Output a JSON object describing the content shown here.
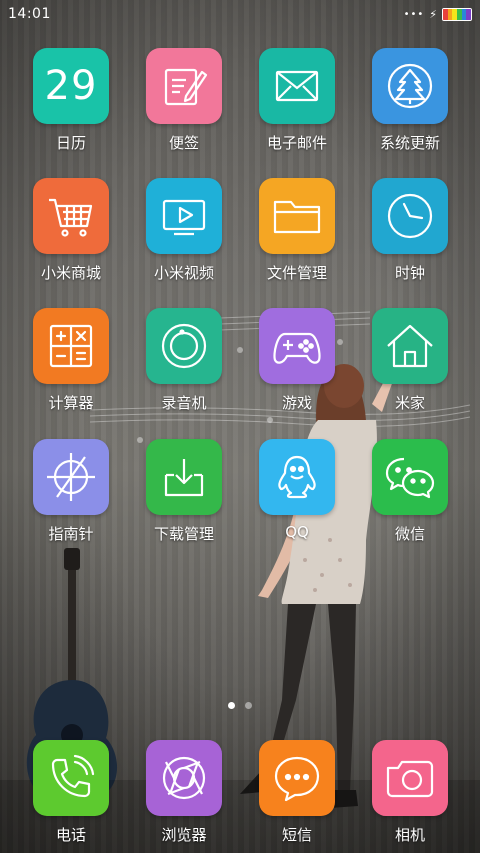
{
  "status_bar": {
    "time": "14:01",
    "dots": "•••",
    "charging_icon": "bolt-icon",
    "battery_colors": [
      "#e8423c",
      "#f6a31d",
      "#f3e51b",
      "#3bbd4a",
      "#2a87d8",
      "#7b3fc7"
    ]
  },
  "apps": {
    "calendar": {
      "label": "日历",
      "day": "29",
      "color": "#19c3a8",
      "icon": "calendar-icon"
    },
    "notes": {
      "label": "便签",
      "color": "#f2779a",
      "icon": "note-pencil-icon"
    },
    "email": {
      "label": "电子邮件",
      "color": "#19b8a4",
      "icon": "envelope-icon"
    },
    "update": {
      "label": "系统更新",
      "color": "#3a95e0",
      "icon": "tree-update-icon"
    },
    "mall": {
      "label": "小米商城",
      "color": "#ef6b3b",
      "icon": "shopping-cart-icon"
    },
    "video": {
      "label": "小米视频",
      "color": "#1fb0d8",
      "icon": "play-screen-icon"
    },
    "files": {
      "label": "文件管理",
      "color": "#f5a623",
      "icon": "folder-icon"
    },
    "clock": {
      "label": "时钟",
      "color": "#21a7d0",
      "icon": "clock-icon"
    },
    "calculator": {
      "label": "计算器",
      "color": "#f27a22",
      "icon": "calculator-icon"
    },
    "recorder": {
      "label": "录音机",
      "color": "#26b58f",
      "icon": "record-icon"
    },
    "games": {
      "label": "游戏",
      "color": "#a06ddf",
      "icon": "gamepad-icon"
    },
    "mihome": {
      "label": "米家",
      "color": "#27b385",
      "icon": "house-icon"
    },
    "compass": {
      "label": "指南针",
      "color": "#8b8fe8",
      "icon": "compass-icon"
    },
    "downloads": {
      "label": "下载管理",
      "color": "#34b84a",
      "icon": "download-icon"
    },
    "qq": {
      "label": "QQ",
      "color": "#33b7ef",
      "icon": "penguin-icon"
    },
    "wechat": {
      "label": "微信",
      "color": "#2bbd4c",
      "icon": "wechat-bubbles-icon"
    }
  },
  "dock": {
    "phone": {
      "label": "电话",
      "color": "#5dca2f",
      "icon": "phone-icon"
    },
    "browser": {
      "label": "浏览器",
      "color": "#a763d6",
      "icon": "aperture-icon"
    },
    "sms": {
      "label": "短信",
      "color": "#f7821d",
      "icon": "chat-bubble-icon"
    },
    "camera": {
      "label": "相机",
      "color": "#f4658c",
      "icon": "camera-icon"
    }
  },
  "page_indicator": {
    "count": 2,
    "active": 1
  }
}
